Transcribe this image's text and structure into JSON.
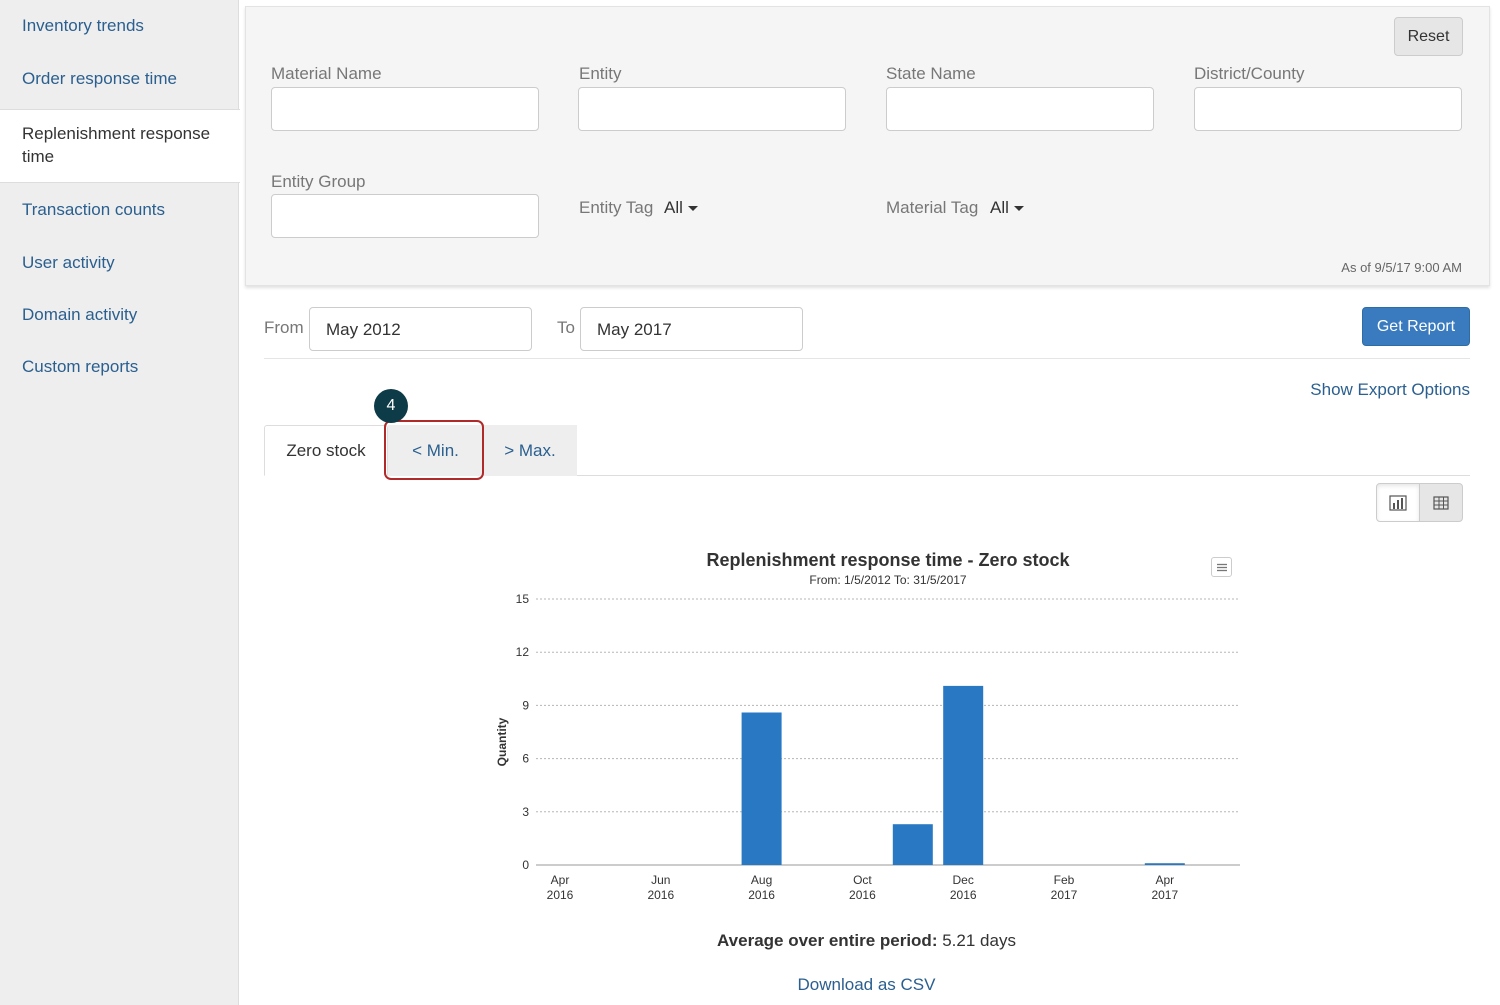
{
  "sidebar": {
    "items": [
      {
        "label": "Inventory trends"
      },
      {
        "label": "Order response time"
      },
      {
        "label": "Replenishment response time"
      },
      {
        "label": "Transaction counts"
      },
      {
        "label": "User activity"
      },
      {
        "label": "Domain activity"
      },
      {
        "label": "Custom reports"
      }
    ],
    "active_index": 2
  },
  "filters": {
    "reset_label": "Reset",
    "material_name_label": "Material Name",
    "material_name_value": "",
    "entity_label": "Entity",
    "entity_value": "",
    "state_name_label": "State Name",
    "state_name_value": "",
    "district_label": "District/County",
    "district_value": "",
    "entity_group_label": "Entity Group",
    "entity_group_value": "",
    "entity_tag_label": "Entity Tag",
    "entity_tag_value": "All",
    "material_tag_label": "Material Tag",
    "material_tag_value": "All",
    "as_of": "As of 9/5/17 9:00 AM"
  },
  "date_range": {
    "from_label": "From",
    "from_value": "May 2012",
    "to_label": "To",
    "to_value": "May 2017",
    "get_report_label": "Get Report"
  },
  "export_link": "Show Export Options",
  "tabs": [
    {
      "label": "Zero stock",
      "active": true
    },
    {
      "label": "< Min.",
      "active": false
    },
    {
      "label": "> Max.",
      "active": false
    }
  ],
  "step_badge": "4",
  "view_toggle": {
    "left_icon": "chart-icon",
    "right_icon": "table-icon"
  },
  "chart": {
    "title": "Replenishment response time - Zero stock",
    "subtitle": "From: 1/5/2012 To: 31/5/2017",
    "menu_icon": "hamburger-icon"
  },
  "chart_data": {
    "type": "bar",
    "title": "Replenishment response time - Zero stock",
    "subtitle": "From: 1/5/2012 To: 31/5/2017",
    "xlabel": "",
    "ylabel": "Quantity",
    "ylim": [
      0,
      15
    ],
    "yticks": [
      0,
      3,
      6,
      9,
      12,
      15
    ],
    "grid": true,
    "categories": [
      "Apr 2016",
      "May 2016",
      "Jun 2016",
      "Jul 2016",
      "Aug 2016",
      "Sep 2016",
      "Oct 2016",
      "Nov 2016",
      "Dec 2016",
      "Jan 2017",
      "Feb 2017",
      "Mar 2017",
      "Apr 2017"
    ],
    "tick_labels": [
      {
        "line1": "Apr",
        "line2": "2016"
      },
      {
        "line1": "Jun",
        "line2": "2016"
      },
      {
        "line1": "Aug",
        "line2": "2016"
      },
      {
        "line1": "Oct",
        "line2": "2016"
      },
      {
        "line1": "Dec",
        "line2": "2016"
      },
      {
        "line1": "Feb",
        "line2": "2017"
      },
      {
        "line1": "Apr",
        "line2": "2017"
      }
    ],
    "values": [
      0,
      0,
      0,
      0,
      8.6,
      0,
      0,
      2.3,
      10.1,
      0,
      0,
      0,
      0.1
    ],
    "color": "#2878c4"
  },
  "average": {
    "label": "Average over entire period:",
    "value": "5.21 days"
  },
  "download_csv": "Download as CSV"
}
